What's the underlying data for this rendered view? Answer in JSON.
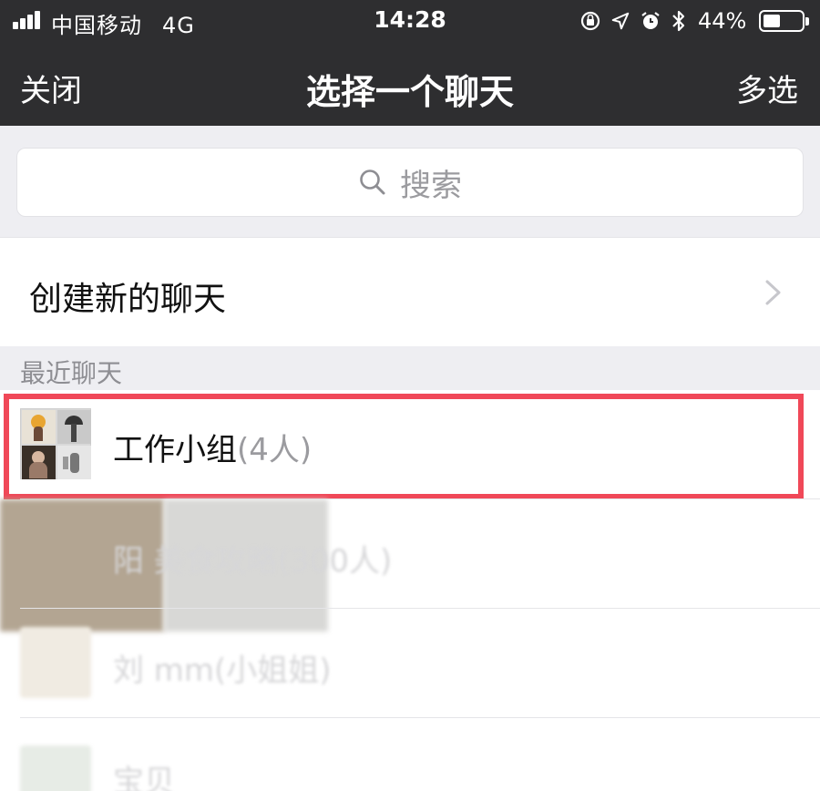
{
  "status_bar": {
    "carrier": "中国移动",
    "network": "4G",
    "time": "14:28",
    "battery_percent": "44%",
    "icons": [
      "signal-icon",
      "rotation-lock-icon",
      "location-arrow-icon",
      "alarm-icon",
      "bluetooth-icon",
      "battery-icon"
    ]
  },
  "nav": {
    "close_label": "关闭",
    "title": "选择一个聊天",
    "multi_select_label": "多选"
  },
  "search": {
    "placeholder": "搜索"
  },
  "create_chat": {
    "label": "创建新的聊天"
  },
  "recent": {
    "section_label": "最近聊天",
    "items": [
      {
        "name": "工作小组",
        "count": "(4人)",
        "highlighted": true
      },
      {
        "name": "阳 美食攻略",
        "count": "(300人)",
        "blurred": true
      },
      {
        "name": "刘 mm(小姐姐)",
        "count": "",
        "blurred": true
      },
      {
        "name": "宝贝",
        "count": "",
        "blurred": true
      }
    ]
  },
  "colors": {
    "nav_bg": "#2e2e30",
    "page_bg": "#eeeef2",
    "highlight": "#f04858",
    "secondary_text": "#8e8e93"
  }
}
